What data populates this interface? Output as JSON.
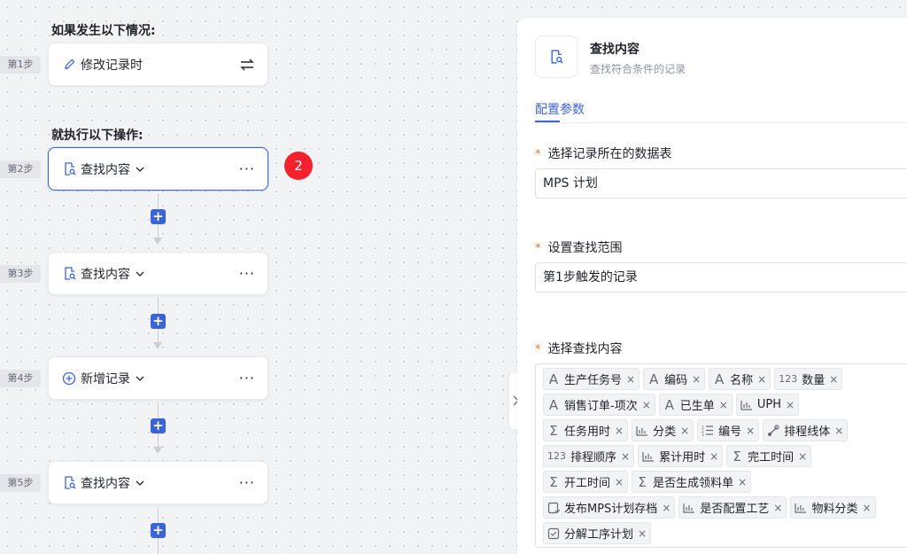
{
  "flow": {
    "trigger_heading": "如果发生以下情况:",
    "action_heading": "就执行以下操作:",
    "steps": [
      {
        "tag": "第1步",
        "label": "修改记录时",
        "icon": "pencil-icon"
      },
      {
        "tag": "第2步",
        "label": "查找内容",
        "icon": "find-record-icon"
      },
      {
        "tag": "第3步",
        "label": "查找内容",
        "icon": "find-record-icon"
      },
      {
        "tag": "第4步",
        "label": "新增记录",
        "icon": "add-circle-icon"
      },
      {
        "tag": "第5步",
        "label": "查找内容",
        "icon": "find-record-icon"
      }
    ],
    "more_label": "···",
    "add_label": "+",
    "notification_count": "2"
  },
  "panel": {
    "title": "查找内容",
    "subtitle": "查找符合条件的记录",
    "tab": "配置参数",
    "required_mark": "*",
    "fields": [
      {
        "label": "选择记录所在的数据表",
        "value": "MPS 计划"
      },
      {
        "label": "设置查找范围",
        "value": "第1步触发的记录"
      },
      {
        "label": "选择查找内容"
      }
    ],
    "tag_rows": [
      [
        {
          "icon": "A",
          "label": "生产任务号"
        },
        {
          "icon": "A",
          "label": "编码"
        },
        {
          "icon": "A",
          "label": "名称"
        },
        {
          "icon": "123",
          "label": "数量"
        }
      ],
      [
        {
          "icon": "A",
          "label": "销售订单-项次"
        },
        {
          "icon": "A",
          "label": "已生单"
        },
        {
          "icon": "bar",
          "label": "UPH"
        }
      ],
      [
        {
          "icon": "Σ",
          "label": "任务用时"
        },
        {
          "icon": "bar",
          "label": "分类"
        },
        {
          "icon": "list",
          "label": "编号"
        },
        {
          "icon": "link",
          "label": "排程线体"
        }
      ],
      [
        {
          "icon": "123",
          "label": "排程顺序"
        },
        {
          "icon": "bar",
          "label": "累计用时"
        },
        {
          "icon": "Σ",
          "label": "完工时间"
        }
      ],
      [
        {
          "icon": "Σ",
          "label": "开工时间"
        },
        {
          "icon": "Σ",
          "label": "是否生成领料单"
        }
      ],
      [
        {
          "icon": "doc",
          "label": "发布MPS计划存档"
        },
        {
          "icon": "bar",
          "label": "是否配置工艺"
        },
        {
          "icon": "bar",
          "label": "物料分类"
        }
      ],
      [
        {
          "icon": "check",
          "label": "分解工序计划"
        }
      ]
    ],
    "remove_glyph": "×"
  }
}
